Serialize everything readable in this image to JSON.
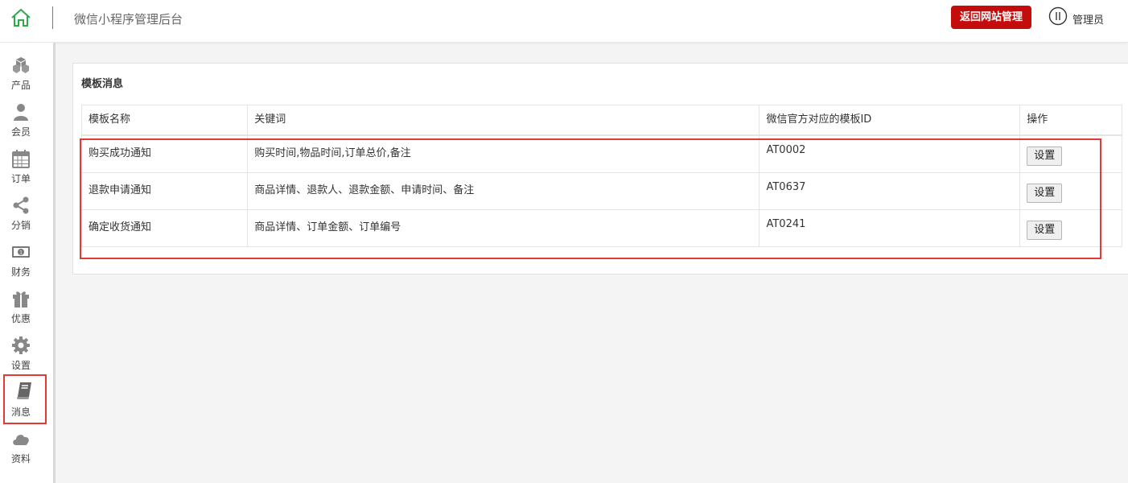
{
  "header": {
    "app_title": "微信小程序管理后台",
    "back_button": "返回网站管理",
    "user_label": "管理员",
    "accent_color": "#2eaa4a",
    "back_button_color": "#c40c0c"
  },
  "sidebar": {
    "items": [
      {
        "label": "产品",
        "icon": "cubes-icon"
      },
      {
        "label": "会员",
        "icon": "user-icon"
      },
      {
        "label": "订单",
        "icon": "calendar-icon"
      },
      {
        "label": "分销",
        "icon": "share-icon"
      },
      {
        "label": "财务",
        "icon": "money-icon"
      },
      {
        "label": "优惠",
        "icon": "gift-icon"
      },
      {
        "label": "设置",
        "icon": "gear-icon"
      },
      {
        "label": "消息",
        "icon": "book-icon",
        "active": true
      },
      {
        "label": "资料",
        "icon": "cloud-icon"
      }
    ]
  },
  "panel": {
    "title": "模板消息",
    "columns": [
      "模板名称",
      "关键词",
      "微信官方对应的模板ID",
      "操作"
    ],
    "rows": [
      {
        "name": "购买成功通知",
        "keywords": "购买时间,物品时间,订单总价,备注",
        "template_id": "AT0002",
        "action": "设置"
      },
      {
        "name": "退款申请通知",
        "keywords": "商品详情、退款人、退款金额、申请时间、备注",
        "template_id": "AT0637",
        "action": "设置"
      },
      {
        "name": "确定收货通知",
        "keywords": "商品详情、订单金额、订单编号",
        "template_id": "AT0241",
        "action": "设置"
      }
    ]
  },
  "highlight_color": "#e53935"
}
